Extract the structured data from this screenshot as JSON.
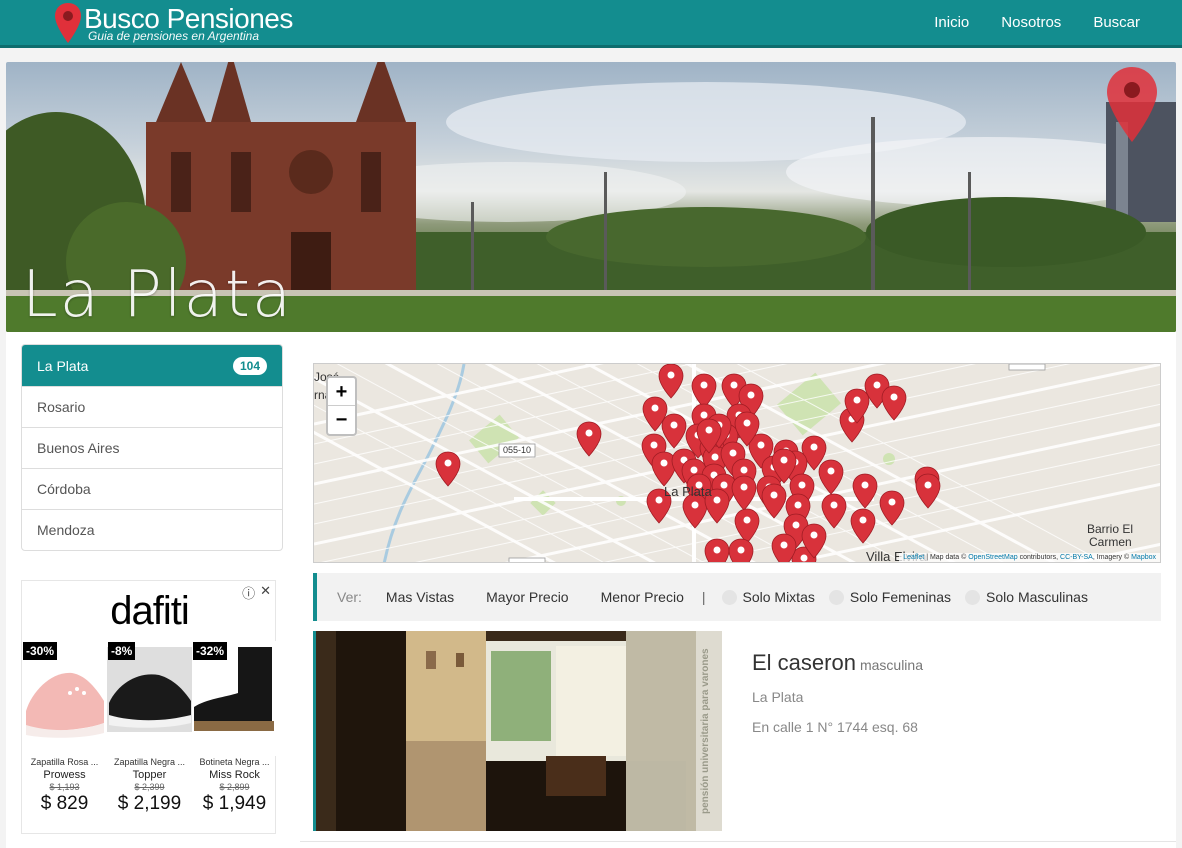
{
  "brand": {
    "title": "Busco Pensiones",
    "subtitle": "Guia de pensiones en Argentina",
    "accent_color": "#138d8f",
    "pin_color": "#e0303a"
  },
  "nav": {
    "items": [
      {
        "label": "Inicio"
      },
      {
        "label": "Nosotros"
      },
      {
        "label": "Buscar"
      }
    ]
  },
  "hero": {
    "title": "La Plata"
  },
  "cities": [
    {
      "label": "La Plata",
      "count": "104",
      "active": true
    },
    {
      "label": "Rosario"
    },
    {
      "label": "Buenos Aires"
    },
    {
      "label": "Córdoba"
    },
    {
      "label": "Mendoza"
    }
  ],
  "ad": {
    "brand": "dafiti",
    "products": [
      {
        "discount": "-30%",
        "name": "Zapatilla Rosa ...",
        "brand": "Prowess",
        "old_price": "$ 1,193",
        "price": "$ 829"
      },
      {
        "discount": "-8%",
        "name": "Zapatilla Negra ...",
        "brand": "Topper",
        "old_price": "$ 2,399",
        "price": "$ 2,199"
      },
      {
        "discount": "-32%",
        "name": "Botineta Negra ...",
        "brand": "Miss Rock",
        "old_price": "$ 2,899",
        "price": "$ 1,949"
      }
    ]
  },
  "map": {
    "zoom_in": "+",
    "zoom_out": "−",
    "labels": {
      "jose": "José",
      "hernandez": "rnández",
      "barrio1": "Barrio El",
      "barrio2": "Carmen",
      "villa": "Villa Elvira",
      "la_plata": "La Plata",
      "route": "055-10"
    },
    "attribution": {
      "leaflet": "Leaflet",
      "data": " | Map data © ",
      "osm": "OpenStreetMap",
      "contrib": " contributors, ",
      "license": "CC-BY-SA",
      "imagery": ", Imagery © ",
      "mapbox": "Mapbox"
    }
  },
  "filters": {
    "ver": "Ver:",
    "options": [
      "Mas Vistas",
      "Mayor Precio",
      "Menor Precio"
    ],
    "separator": "|",
    "radios": [
      "Solo Mixtas",
      "Solo Femeninas",
      "Solo Masculinas"
    ]
  },
  "listing": {
    "name": "El caseron",
    "type": "masculina",
    "city": "La Plata",
    "address": "En calle 1 N° 1744 esq. 68",
    "photo_watermark": "pensión universitaria para varones"
  }
}
